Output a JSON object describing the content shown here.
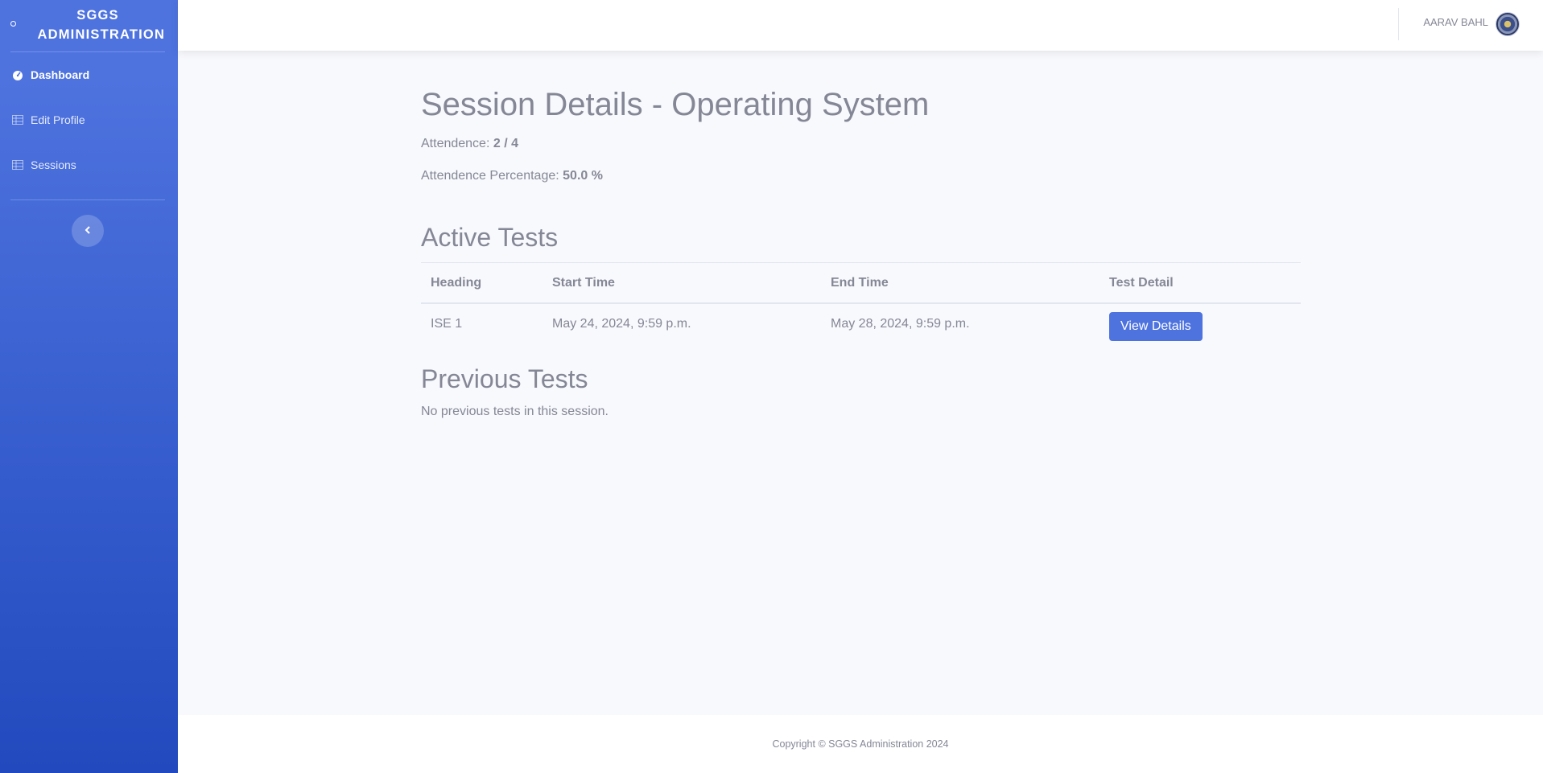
{
  "sidebar": {
    "brand": "SGGS ADMINISTRATION",
    "items": [
      {
        "label": "Dashboard",
        "icon": "tachometer-icon",
        "active": true
      },
      {
        "label": "Edit Profile",
        "icon": "table-icon",
        "active": false
      },
      {
        "label": "Sessions",
        "icon": "table-icon",
        "active": false
      }
    ],
    "toggle_icon": "chevron-left-icon"
  },
  "topbar": {
    "user_name": "AARAV BAHL",
    "avatar_icon": "user-avatar"
  },
  "main": {
    "title": "Session Details - Operating System",
    "attendance_label": "Attendence:",
    "attendance_value": "2 / 4",
    "percentage_label": "Attendence Percentage:",
    "percentage_value": "50.0 %",
    "active_tests": {
      "title": "Active Tests",
      "columns": [
        "Heading",
        "Start Time",
        "End Time",
        "Test Detail"
      ],
      "rows": [
        {
          "heading": "ISE 1",
          "start": "May 24, 2024, 9:59 p.m.",
          "end": "May 28, 2024, 9:59 p.m.",
          "action": "View Details"
        }
      ]
    },
    "previous_tests": {
      "title": "Previous Tests",
      "empty_message": "No previous tests in this session."
    }
  },
  "footer": {
    "copyright": "Copyright © SGGS Administration 2024"
  },
  "colors": {
    "primary": "#4e73df",
    "sidebar_gradient_end": "#224abe",
    "text": "#858796",
    "background": "#f8f9fc"
  }
}
